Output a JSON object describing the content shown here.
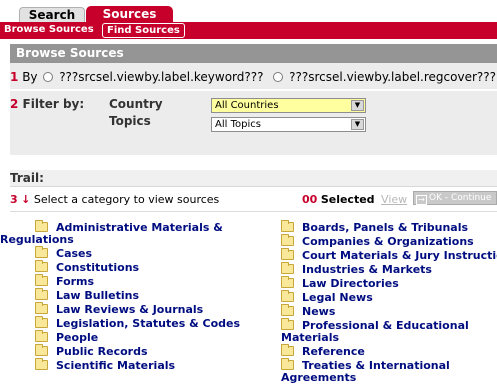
{
  "tabs": {
    "search": "Search",
    "sources": "Sources"
  },
  "subtabs": {
    "browse": "Browse Sources",
    "find": "Find Sources"
  },
  "panel": {
    "header": "Browse Sources",
    "step1_num": "1",
    "step1_label": "By",
    "radio1_label": "???srcsel.viewby.label.keyword???",
    "radio2_label": "???srcsel.viewby.label.regcover???",
    "step2_num": "2",
    "filter_label": "Filter by:",
    "country_label": "Country",
    "country_value": "All Countries",
    "topics_label": "Topics",
    "topics_value": "All Topics"
  },
  "trail": {
    "label": "Trail:",
    "step3_num": "3",
    "instruction": "Select a category to view sources",
    "count": "00",
    "selected_label": "Selected",
    "view_link": "View",
    "ok_button": "OK - Continue"
  },
  "categories_left": [
    {
      "line1": "Administrative Materials &",
      "line2": "Regulations"
    },
    {
      "line1": "Cases"
    },
    {
      "line1": "Constitutions"
    },
    {
      "line1": "Forms"
    },
    {
      "line1": "Law Bulletins"
    },
    {
      "line1": "Law Reviews & Journals"
    },
    {
      "line1": "Legislation, Statutes & Codes"
    },
    {
      "line1": "People"
    },
    {
      "line1": "Public Records"
    },
    {
      "line1": "Scientific Materials"
    }
  ],
  "categories_right": [
    {
      "line1": "Boards, Panels & Tribunals"
    },
    {
      "line1": "Companies & Organizations"
    },
    {
      "line1": "Court Materials & Jury Instructions"
    },
    {
      "line1": "Industries & Markets"
    },
    {
      "line1": "Law Directories"
    },
    {
      "line1": "Legal News"
    },
    {
      "line1": "News"
    },
    {
      "line1": "Professional & Educational",
      "line2": "Materials"
    },
    {
      "line1": "Reference"
    },
    {
      "line1": "Treaties & International",
      "line2": "Agreements"
    }
  ],
  "colors": {
    "brand_red": "#c6002b",
    "link_blue": "#000d80",
    "panel_gray": "#ececec",
    "header_gray": "#959595"
  }
}
